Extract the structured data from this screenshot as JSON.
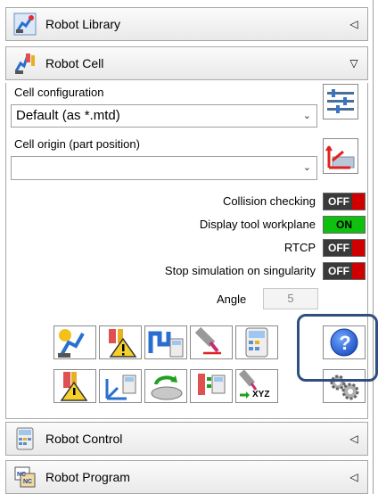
{
  "panels": {
    "robot_library": {
      "title": "Robot Library",
      "arrow": "◁"
    },
    "robot_cell": {
      "title": "Robot Cell",
      "arrow": "▽"
    },
    "robot_control": {
      "title": "Robot Control",
      "arrow": "◁"
    },
    "robot_program": {
      "title": "Robot Program",
      "arrow": "◁"
    }
  },
  "cell": {
    "config_label": "Cell configuration",
    "config_value": "Default (as *.mtd)",
    "origin_label": "Cell origin (part position)",
    "origin_value": "",
    "toggles": [
      {
        "label": "Collision checking",
        "state": "OFF"
      },
      {
        "label": "Display tool workplane",
        "state": "ON"
      },
      {
        "label": "RTCP",
        "state": "OFF"
      },
      {
        "label": "Stop simulation on singularity",
        "state": "OFF"
      }
    ],
    "angle_label": "Angle",
    "angle_value": "5"
  },
  "tools": {
    "xyz_text": "XYZ",
    "help_glyph": "?"
  },
  "colors": {
    "on": "#10c010",
    "off_dark": "#3a3a3a",
    "off_red": "#d00000",
    "help_blue": "#1f5fd6",
    "highlight": "#2f4f7f"
  }
}
